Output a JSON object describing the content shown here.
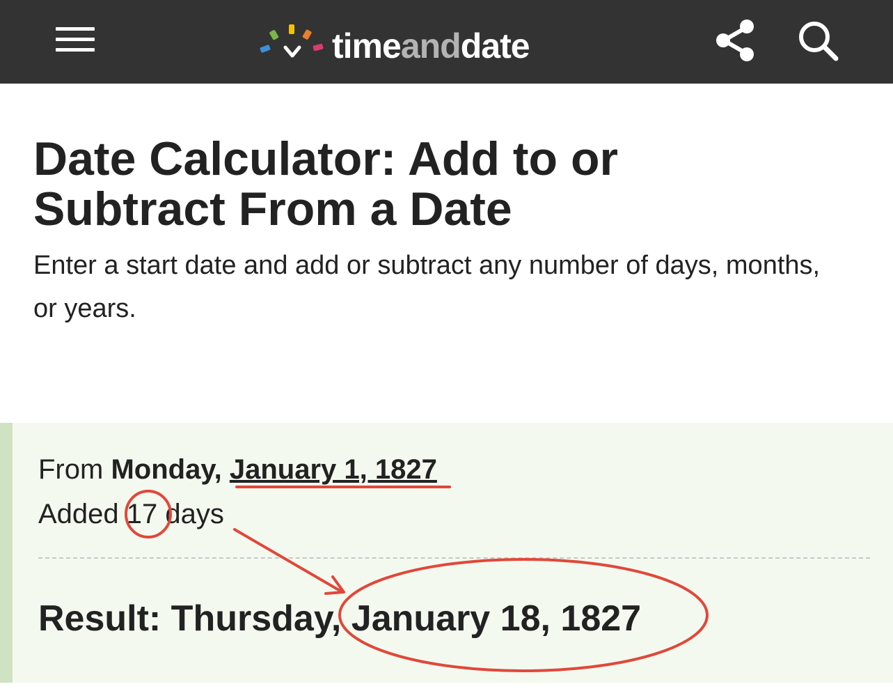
{
  "header": {
    "logo": {
      "text_start": "time",
      "text_mid": "and",
      "text_end": "date"
    }
  },
  "page": {
    "title": "Date Calculator: Add to or Subtract From a Date",
    "intro": "Enter a start date and add or subtract any number of days, months, or years."
  },
  "result_panel": {
    "from_label": "From",
    "from_weekday": "Monday,",
    "from_date": "January 1, 1827",
    "added_label": "Added",
    "added_value": "17",
    "added_unit": "days",
    "result_label": "Result: Thursday,",
    "result_date": "January 18, 1827"
  },
  "colors": {
    "topbar": "#333333",
    "panel_bg": "#f4f9ef",
    "panel_border": "#cfe2c2",
    "annotation": "#e0483a",
    "logo_marks": [
      "#3d8fd6",
      "#7ab648",
      "#f2c200",
      "#e87f2e",
      "#d93d6c"
    ]
  },
  "icons": {
    "menu": "hamburger-menu-icon",
    "share": "share-icon",
    "search": "search-icon",
    "logo": "timeanddate-logo-mark-icon"
  }
}
